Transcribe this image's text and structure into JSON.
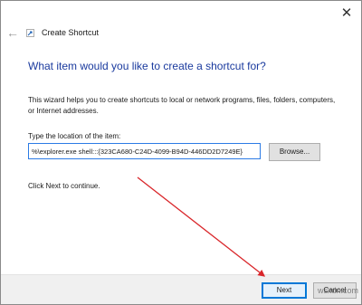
{
  "window": {
    "close_glyph": "✕",
    "back_glyph": "←"
  },
  "header": {
    "title": "Create Shortcut"
  },
  "main": {
    "heading": "What item would you like to create a shortcut for?",
    "description": "This wizard helps you to create shortcuts to local or network programs, files, folders, computers, or Internet addresses.",
    "location_label": "Type the location of the item:",
    "location_value": "%\\explorer.exe shell:::{323CA680-C24D-4099-B94D-446DD2D7249E}",
    "browse_label": "Browse...",
    "continue_text": "Click Next to continue."
  },
  "footer": {
    "next_label": "Next",
    "cancel_label": "Cancel"
  },
  "watermark": "wsxdn.com",
  "colors": {
    "heading": "#1a3a9e",
    "arrow": "#d9262a",
    "input_border": "#2c7be5",
    "primary_button_border": "#0078d7"
  },
  "icons": {
    "back": "back-arrow-icon",
    "app": "shortcut-app-icon",
    "close": "close-icon"
  }
}
